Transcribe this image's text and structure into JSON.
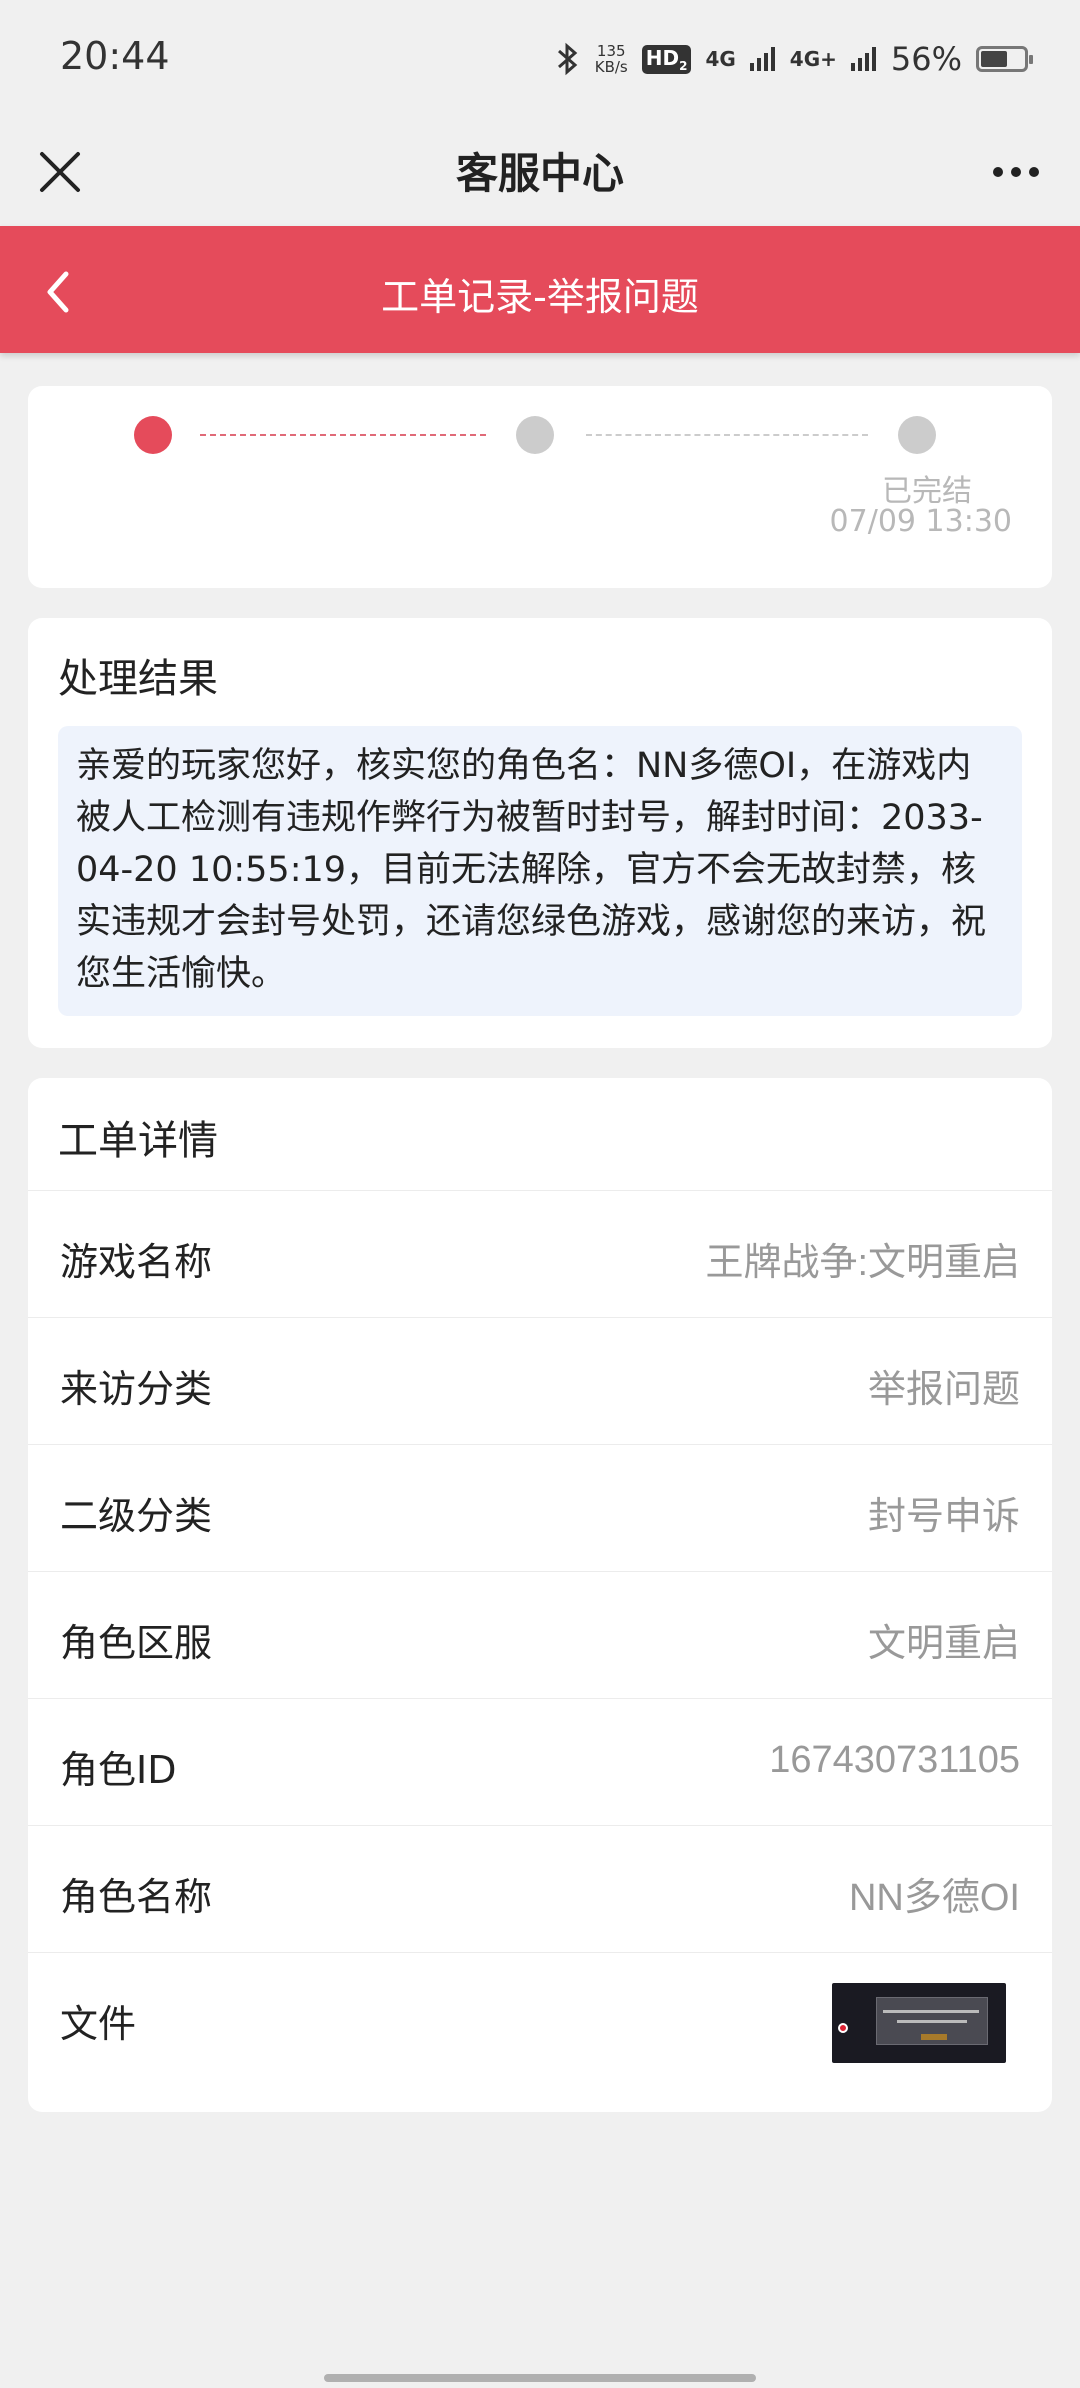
{
  "status_bar": {
    "time": "20:44",
    "speed_value": "135",
    "speed_unit": "KB/s",
    "hd_label": "HD",
    "hd_sub": "2",
    "network1": "4G",
    "network2": "4G+",
    "battery": "56%"
  },
  "titlebar": {
    "title": "客服中心",
    "close_icon": "close-icon",
    "more_icon": "more-icon"
  },
  "header": {
    "title": "工单记录-举报问题",
    "back_icon": "chevron-left-icon",
    "color": "#e54b5b"
  },
  "progress": {
    "steps": [
      {
        "state": "active",
        "color": "#e54b5b"
      },
      {
        "state": "pending",
        "color": "#cccccc"
      },
      {
        "state": "done",
        "color": "#cccccc",
        "label": "已完结",
        "date": "07/09 13:30"
      }
    ]
  },
  "result": {
    "title": "处理结果",
    "text": "亲爱的玩家您好，核实您的角色名：NN多德OI，在游戏内被人工检测有违规作弊行为被暂时封号，解封时间：2033-04-20 10:55:19，目前无法解除，官方不会无故封禁，核实违规才会封号处罚，还请您绿色游戏，感谢您的来访，祝您生活愉快。"
  },
  "details": {
    "title": "工单详情",
    "rows": [
      {
        "label": "游戏名称",
        "value": "王牌战争:文明重启"
      },
      {
        "label": "来访分类",
        "value": "举报问题"
      },
      {
        "label": "二级分类",
        "value": "封号申诉"
      },
      {
        "label": "角色区服",
        "value": "文明重启"
      },
      {
        "label": "角色ID",
        "value": "167430731105"
      },
      {
        "label": "角色名称",
        "value": "NN多德OI"
      }
    ],
    "file_label": "文件"
  }
}
